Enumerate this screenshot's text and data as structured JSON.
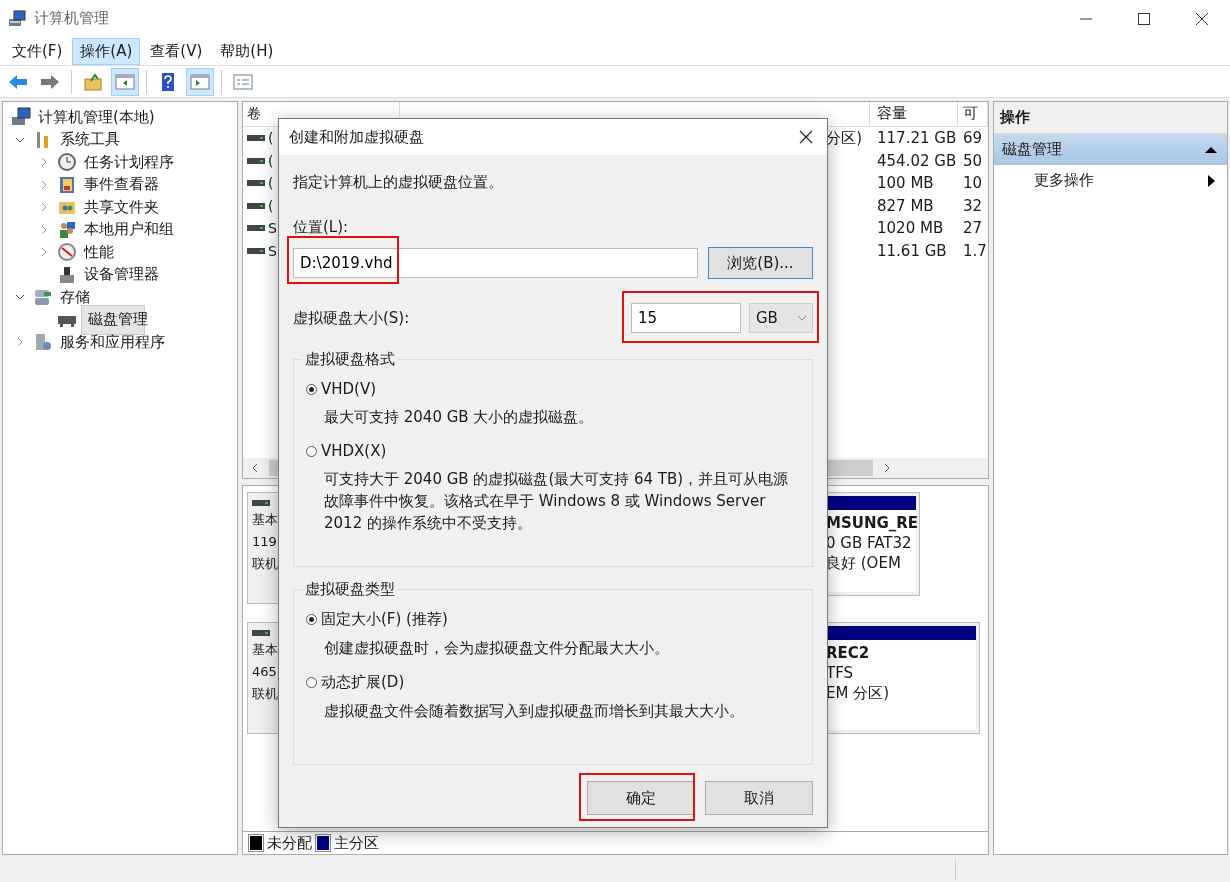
{
  "window": {
    "title": "计算机管理"
  },
  "menu": [
    {
      "label": "文件(F)",
      "selected": false
    },
    {
      "label": "操作(A)",
      "selected": true
    },
    {
      "label": "查看(V)",
      "selected": false
    },
    {
      "label": "帮助(H)",
      "selected": false
    }
  ],
  "toolbar": [
    {
      "pressed": false
    },
    {
      "pressed": false
    },
    {
      "pressed": false
    },
    {
      "pressed": true
    },
    {
      "pressed": false
    },
    {
      "pressed": true
    },
    {
      "pressed": false
    }
  ],
  "tree": [
    {
      "label": "计算机管理(本地)",
      "selected": false,
      "children": [
        {
          "label": "系统工具",
          "expanded": true,
          "selected": false,
          "children": [
            {
              "label": "任务计划程序",
              "expanded": false,
              "selected": false
            },
            {
              "label": "事件查看器",
              "expanded": false,
              "selected": false
            },
            {
              "label": "共享文件夹",
              "expanded": false,
              "selected": false
            },
            {
              "label": "本地用户和组",
              "expanded": false,
              "selected": false
            },
            {
              "label": "性能",
              "expanded": false,
              "selected": false
            },
            {
              "label": "设备管理器",
              "selected": false
            }
          ]
        },
        {
          "label": "存储",
          "expanded": true,
          "selected": false,
          "children": [
            {
              "label": "磁盘管理",
              "selected": true
            }
          ]
        },
        {
          "label": "服务和应用程序",
          "expanded": false,
          "selected": false
        }
      ]
    }
  ],
  "volume_table": {
    "columns": [
      "卷",
      "可"
    ],
    "rows": [
      {
        "volume": "(",
        "status": "分区)",
        "capacity": "117.21 GB",
        "free": "69"
      },
      {
        "volume": "(",
        "capacity": "454.02 GB",
        "free": "50"
      },
      {
        "volume": "(",
        "capacity": "100 MB",
        "free": "10"
      },
      {
        "volume": "(",
        "capacity": "827 MB",
        "free": "32"
      },
      {
        "volume": "S",
        "capacity": "1020 MB",
        "free": "27"
      },
      {
        "volume": "S",
        "capacity": "11.61 GB",
        "free": "1.7"
      }
    ],
    "capacity_header": "容量"
  },
  "disks": [
    {
      "lines": [
        "基本",
        "119",
        "联机"
      ],
      "partition_lines": [
        "MSUNG_RE",
        "0 GB FAT32",
        "良好 (OEM"
      ]
    },
    {
      "lines": [
        "基本",
        "465",
        "联机"
      ],
      "partition_lines": [
        "REC2",
        "TFS",
        "EM 分区)"
      ]
    }
  ],
  "legend": [
    {
      "label": "未分配",
      "color": "#000000"
    },
    {
      "label": "主分区",
      "color": "#000080"
    }
  ],
  "actions": {
    "title": "操作",
    "section": "磁盘管理",
    "items": [
      "更多操作"
    ]
  },
  "dialog": {
    "title": "创建和附加虚拟硬盘",
    "intro": "指定计算机上的虚拟硬盘位置。",
    "location": {
      "label": "位置(L):",
      "value": "D:\\2019.vhd",
      "browse": "浏览(B)...",
      "highlighted": true
    },
    "size": {
      "label": "虚拟硬盘大小(S):",
      "value": "15",
      "unit": "GB",
      "highlighted": true
    },
    "groups": [
      {
        "title": "虚拟硬盘格式",
        "options": [
          {
            "label": "VHD(V)",
            "selected": true,
            "description": "最大可支持 2040 GB 大小的虚拟磁盘。"
          },
          {
            "label": "VHDX(X)",
            "selected": false,
            "description": "可支持大于 2040 GB 的虚拟磁盘(最大可支持 64 TB)，并且可从电源故障事件中恢复。该格式在早于 Windows 8 或 Windows Server 2012 的操作系统中不受支持。"
          }
        ]
      },
      {
        "title": "虚拟硬盘类型",
        "options": [
          {
            "label": "固定大小(F) (推荐)",
            "selected": true,
            "description": "创建虚拟硬盘时，会为虚拟硬盘文件分配最大大小。"
          },
          {
            "label": "动态扩展(D)",
            "selected": false,
            "description": "虚拟硬盘文件会随着数据写入到虚拟硬盘而增长到其最大大小。"
          }
        ]
      }
    ],
    "buttons": [
      {
        "label": "确定",
        "highlighted": true
      },
      {
        "label": "取消",
        "highlighted": false
      }
    ]
  }
}
